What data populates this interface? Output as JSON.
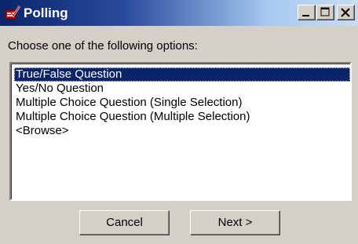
{
  "window": {
    "title": "Polling",
    "controls": {
      "minimize": "minimize-icon",
      "maximize": "maximize-icon",
      "close": "close-icon"
    }
  },
  "dialog": {
    "prompt": "Choose one of the following options:",
    "options": [
      "True/False Question",
      "Yes/No Question",
      "Multiple Choice Question (Single Selection)",
      "Multiple Choice Question (Multiple Selection)",
      "<Browse>"
    ],
    "selected_index": 0
  },
  "buttons": {
    "cancel": "Cancel",
    "next": "Next >"
  },
  "colors": {
    "title_bar_start": "#0a246a",
    "selection": "#0a246a",
    "face": "#d4d0c8"
  }
}
